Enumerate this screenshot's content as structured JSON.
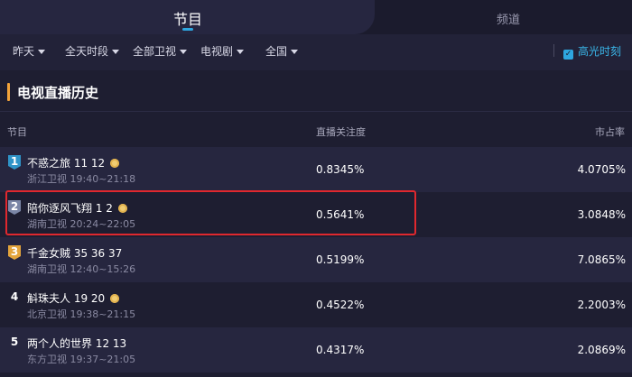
{
  "tabs": {
    "programs": "节目",
    "channels": "频道"
  },
  "filters": [
    {
      "label": "昨天"
    },
    {
      "label": "全天时段"
    },
    {
      "label": "全部卫视"
    },
    {
      "label": "电视剧"
    },
    {
      "label": "全国"
    }
  ],
  "highlight_toggle": {
    "label": "高光时刻",
    "checked": true
  },
  "section": {
    "title": "电视直播历史"
  },
  "columns": {
    "program": "节目",
    "attention": "直播关注度",
    "share": "市占率"
  },
  "rows": [
    {
      "rank": "1",
      "title": "不惑之旅 11 12",
      "channel_time": "浙江卫视 19:40~21:18",
      "attention": "0.8345%",
      "share": "4.0705%"
    },
    {
      "rank": "2",
      "title": "陪你逐风飞翔 1 2",
      "channel_time": "湖南卫视 20:24~22:05",
      "attention": "0.5641%",
      "share": "3.0848%"
    },
    {
      "rank": "3",
      "title": "千金女贼 35 36 37",
      "channel_time": "湖南卫视 12:40~15:26",
      "attention": "0.5199%",
      "share": "7.0865%"
    },
    {
      "rank": "4",
      "title": "斛珠夫人 19 20",
      "channel_time": "北京卫视 19:38~21:15",
      "attention": "0.4522%",
      "share": "2.2003%"
    },
    {
      "rank": "5",
      "title": "两个人的世界 12 13",
      "channel_time": "东方卫视 19:37~21:05",
      "attention": "0.4317%",
      "share": "2.0869%"
    }
  ],
  "colors": {
    "accent": "#2ea7e0",
    "section_bar": "#f2a33a",
    "highlight_box": "#e0282e"
  }
}
